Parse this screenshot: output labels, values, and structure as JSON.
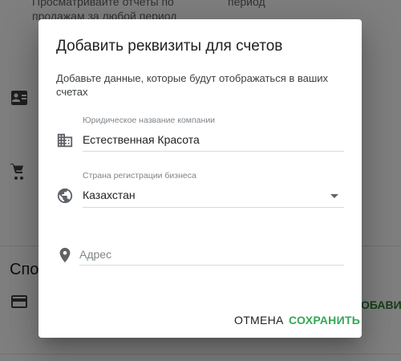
{
  "background": {
    "report_text_line1": "Просматривайте отчеты по",
    "report_text_line2": "продажам за любой период",
    "report_text_right": "период",
    "section_heading": "Спос",
    "side_action_label": "ДОБАВИТЬ",
    "icons": [
      "contact-card-icon",
      "cart-icon",
      "credit-card-icon"
    ]
  },
  "dialog": {
    "title": "Добавить реквизиты для счетов",
    "subtitle": "Добавьте данные, которые будут отображаться в ваших счетах",
    "fields": {
      "company": {
        "label": "Юридическое название компании",
        "value": "Естественная Красота",
        "icon": "building-icon"
      },
      "country": {
        "label": "Страна регистрации бизнеса",
        "value": "Казахстан",
        "icon": "globe-icon"
      },
      "address": {
        "placeholder": "Адрес",
        "value": "",
        "icon": "location-pin-icon"
      }
    },
    "buttons": {
      "cancel": "ОТМЕНА",
      "save": "СОХРАНИТЬ"
    }
  },
  "colors": {
    "accent_green": "#34a853",
    "scrim": "rgba(0,0,0,0.5)",
    "icon_gray": "#5f6368"
  }
}
